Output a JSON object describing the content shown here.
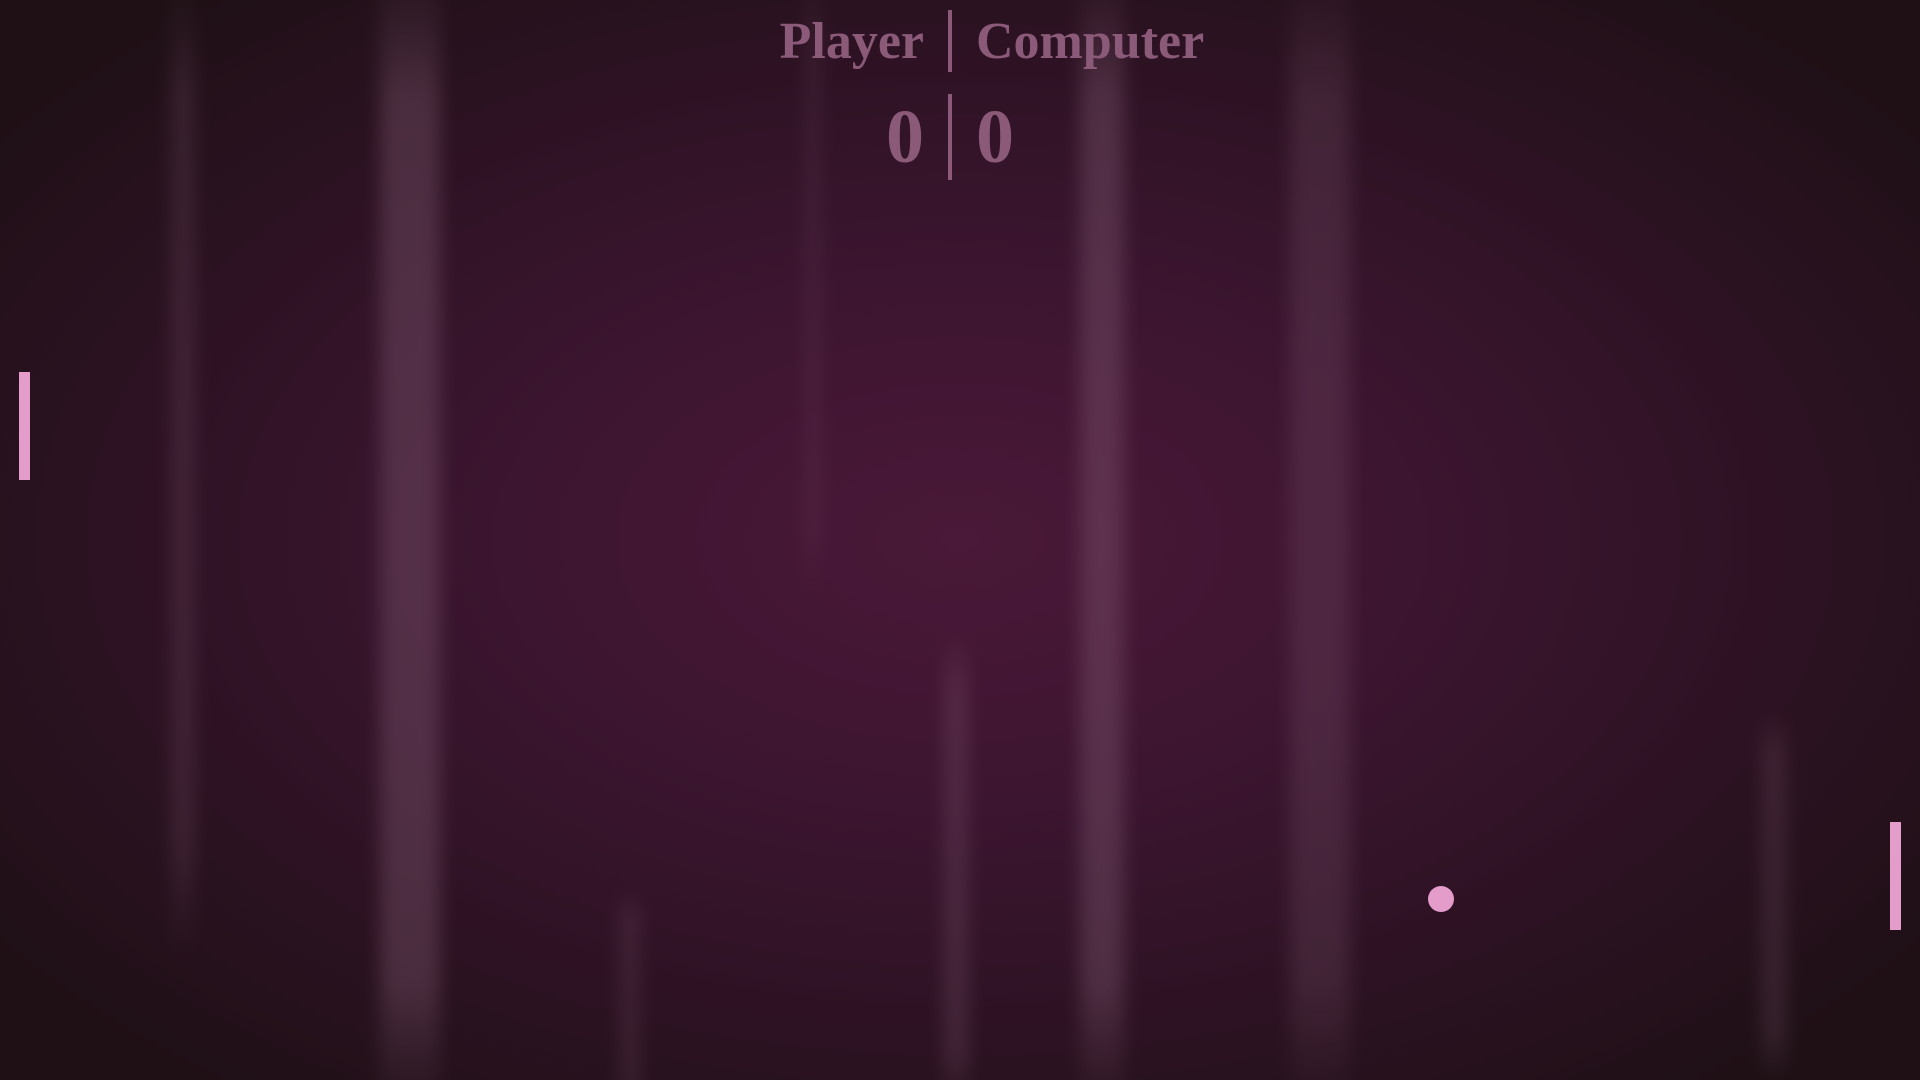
{
  "scoreboard": {
    "player_label": "Player",
    "computer_label": "Computer",
    "player_score": "0",
    "computer_score": "0"
  },
  "colors": {
    "background_center": "#4a1838",
    "background_edge": "#1f1016",
    "score_text": "#8a5a78",
    "paddle": "#e49ccb",
    "ball": "#e49ccb"
  }
}
